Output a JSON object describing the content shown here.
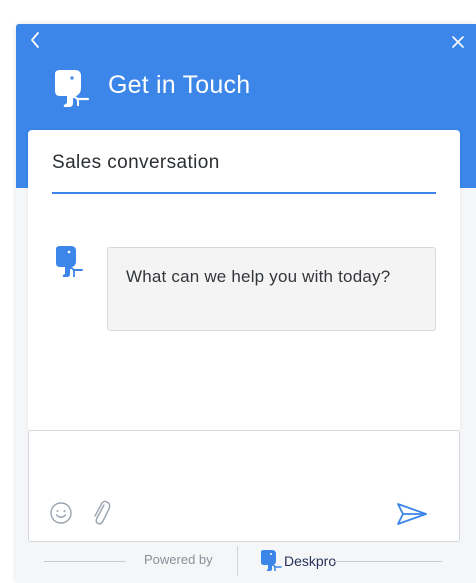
{
  "header": {
    "title": "Get in Touch",
    "back_icon": "chevron-left-icon",
    "close_icon": "close-icon",
    "brand_icon": "deskpro-elephant-icon",
    "background_color": "#3b86e8"
  },
  "conversation": {
    "title": "Sales conversation",
    "accent_color": "#3b86e8",
    "messages": [
      {
        "sender_icon": "deskpro-elephant-icon",
        "text": "What can we help you with today?"
      }
    ]
  },
  "composer": {
    "value": "",
    "emoji_icon": "smiley-icon",
    "attach_icon": "paperclip-icon",
    "send_icon": "send-icon"
  },
  "footer": {
    "powered_by": "Powered by",
    "brand_name": "Deskpro"
  }
}
